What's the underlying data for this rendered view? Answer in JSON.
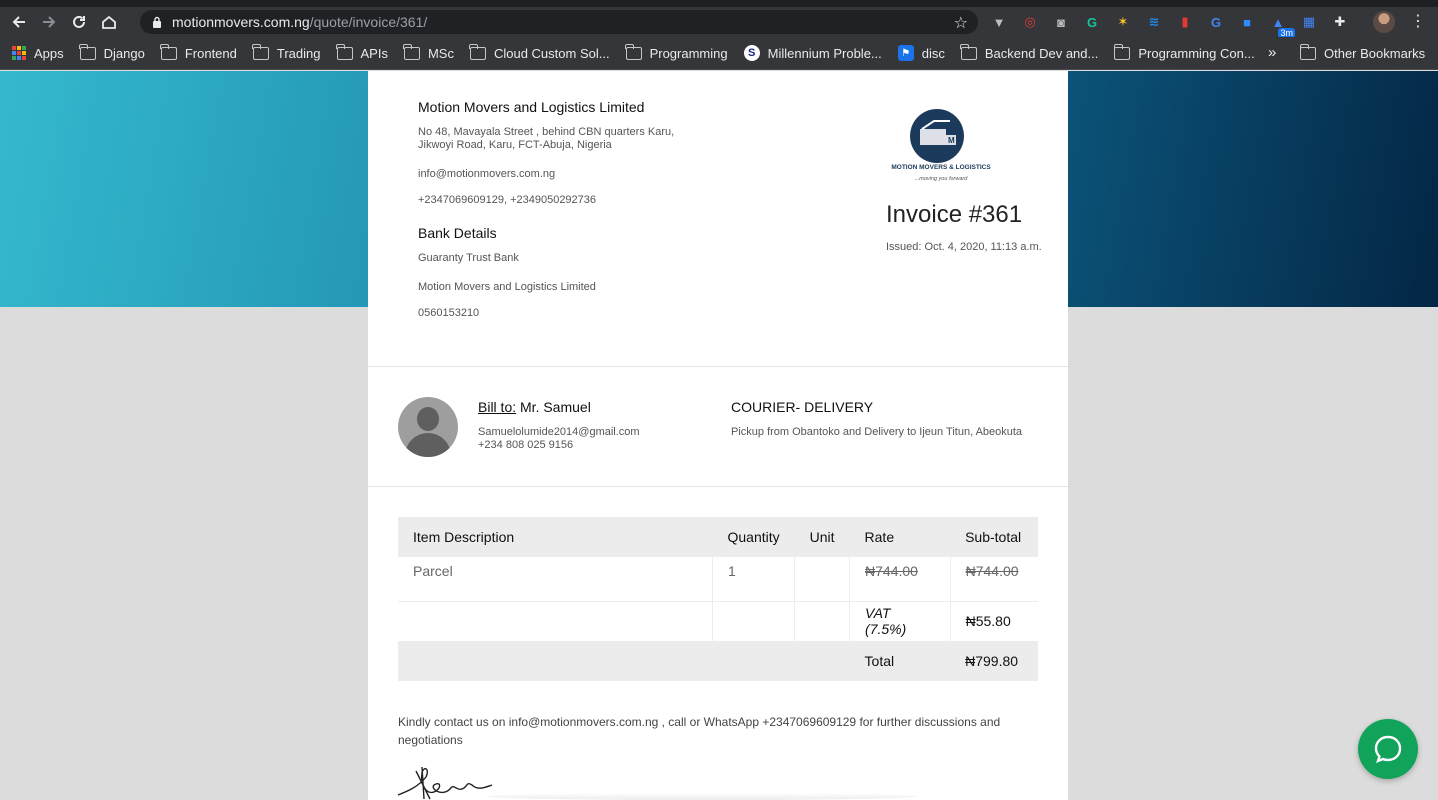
{
  "browser": {
    "url_host": "motionmovers.com.ng",
    "url_path": "/quote/invoice/361/",
    "extensions": [
      {
        "name": "vuetools-icon",
        "glyph": "▼",
        "color": "#bdbdbd"
      },
      {
        "name": "extension-red-icon",
        "glyph": "◎",
        "color": "#e53935"
      },
      {
        "name": "camera-icon",
        "glyph": "◙",
        "color": "#bdbdbd"
      },
      {
        "name": "grammarly-icon",
        "glyph": "G",
        "color": "#15c39a"
      },
      {
        "name": "extension-star-icon",
        "glyph": "✶",
        "color": "#fbc02d"
      },
      {
        "name": "wifi-signal-icon",
        "glyph": "≋",
        "color": "#1e88e5"
      },
      {
        "name": "bookmark-red-icon",
        "glyph": "▮",
        "color": "#e53935"
      },
      {
        "name": "translate-icon",
        "glyph": "G",
        "color": "#4285f4"
      },
      {
        "name": "zoom-icon",
        "glyph": "■",
        "color": "#2d8cff"
      },
      {
        "name": "reminder-icon",
        "glyph": "▲",
        "color": "#4285f4",
        "badge": "3m"
      },
      {
        "name": "grid-extension-icon",
        "glyph": "▦",
        "color": "#4285f4"
      },
      {
        "name": "puzzle-icon",
        "glyph": "✚",
        "color": "#e8eaed"
      }
    ]
  },
  "bookmarks": {
    "items": [
      {
        "label": "Apps",
        "type": "apps"
      },
      {
        "label": "Django",
        "type": "folder"
      },
      {
        "label": "Frontend",
        "type": "folder"
      },
      {
        "label": "Trading",
        "type": "folder"
      },
      {
        "label": "APIs",
        "type": "folder"
      },
      {
        "label": "MSc",
        "type": "folder"
      },
      {
        "label": "Cloud Custom Sol...",
        "type": "folder"
      },
      {
        "label": "Programming",
        "type": "folder"
      },
      {
        "label": "Millennium Proble...",
        "type": "site"
      },
      {
        "label": "disc",
        "type": "flag"
      },
      {
        "label": "Backend Dev and...",
        "type": "folder"
      },
      {
        "label": "Programming Con...",
        "type": "folder"
      }
    ],
    "overflow": "»",
    "other": "Other Bookmarks"
  },
  "company": {
    "name": "Motion Movers and Logistics Limited",
    "address": "No 48, Mavayala Street , behind CBN quarters Karu, Jikwoyi Road, Karu, FCT-Abuja, Nigeria",
    "email": "info@motionmovers.com.ng",
    "phones": "+2347069609129, +2349050292736",
    "logo_text": "MOTION MOVERS & LOGISTICS",
    "logo_tagline": "...moving you forward"
  },
  "bank": {
    "title": "Bank Details",
    "bank_name": "Guaranty Trust Bank",
    "account_name": "Motion Movers and Logistics Limited",
    "account_number": "0560153210"
  },
  "invoice": {
    "title": "Invoice #361",
    "issued": "Issued: Oct. 4, 2020, 11:13 a.m."
  },
  "billing": {
    "label": "Bill to:",
    "name": " Mr. Samuel",
    "email": "Samuelolumide2014@gmail.com",
    "phone": "+234 808 025 9156"
  },
  "service": {
    "title": "COURIER- DELIVERY",
    "description": "Pickup from Obantoko and Delivery to Ijeun Titun, Abeokuta"
  },
  "table": {
    "headers": [
      "Item Description",
      "Quantity",
      "Unit",
      "Rate",
      "Sub-total"
    ],
    "rows": [
      {
        "description": "Parcel",
        "quantity": "1",
        "unit": "",
        "rate": "₦744.00",
        "subtotal": "₦744.00"
      }
    ],
    "vat_label": "VAT (7.5%)",
    "vat_value": "₦55.80",
    "total_label": "Total",
    "total_value": "₦799.80"
  },
  "note": "Kindly contact us on info@motionmovers.com.ng , call or WhatsApp +2347069609129 for further discussions and negotiations",
  "colors": {
    "hero_start": "#35b9cf",
    "hero_end": "#042645",
    "chat_button": "#12a35b",
    "logo_navy": "#1b3a5c"
  }
}
